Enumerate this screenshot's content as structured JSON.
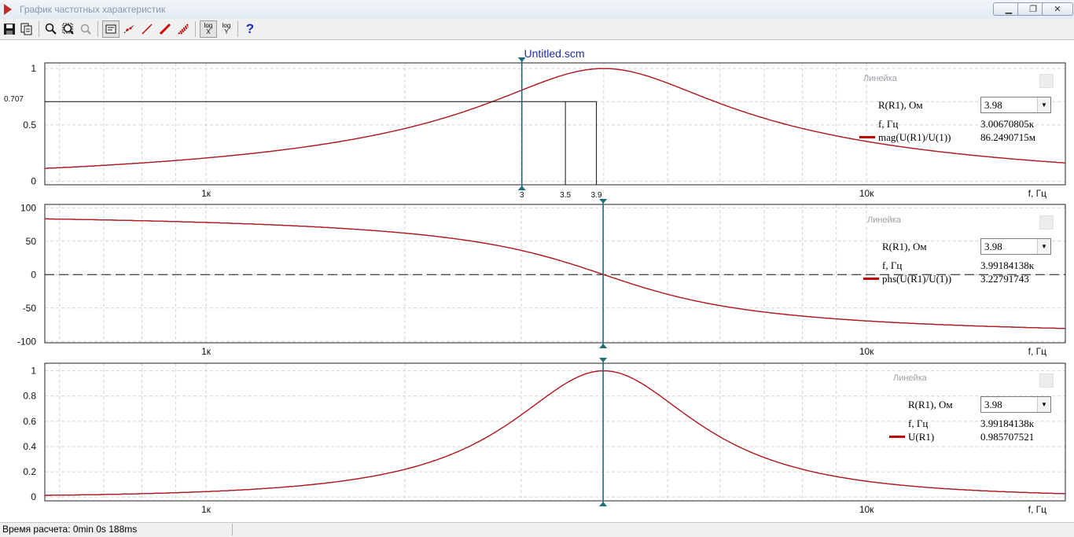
{
  "window": {
    "title": "График частотных характеристик"
  },
  "toolbar": {
    "log_x_1": "log",
    "log_x_2": "X",
    "log_y_1": "log",
    "log_y_2": "Y",
    "help": "?"
  },
  "plot_title": "Untitled.scm",
  "status": {
    "calc_time": "Время расчета: 0min 0s 188ms"
  },
  "colors": {
    "curve_r3": "#2db52d",
    "curve_r35": "#2020b0",
    "curve_r39": "#cc1111",
    "cursor": "#1f6f7a",
    "grid": "#d4d4d4"
  },
  "chart_data": [
    {
      "type": "line",
      "x_scale": "log",
      "xlabel": "f, Гц",
      "x_ticks": [
        {
          "v": 1000,
          "label": "1к"
        },
        {
          "v": 10000,
          "label": "10к"
        }
      ],
      "y_ticks": [
        {
          "v": 1,
          "label": "1"
        },
        {
          "v": 0.707,
          "label": "0.707"
        },
        {
          "v": 0.5,
          "label": "0.5"
        },
        {
          "v": 0,
          "label": "0"
        }
      ],
      "xlim": [
        570,
        20000
      ],
      "ylim": [
        -0.03,
        1.05
      ],
      "quantity": "magnitude",
      "params": [
        3,
        3.5,
        3.9
      ],
      "f0": 4000,
      "series": [
        {
          "param": 3,
          "color": "#2db52d"
        },
        {
          "param": 3.5,
          "color": "#2020b0"
        },
        {
          "param": 3.9,
          "color": "#cc1111"
        }
      ],
      "markers": [
        {
          "label": "3",
          "x": 3007
        },
        {
          "label": "3.5",
          "x": 3500
        },
        {
          "label": "3.9",
          "x": 3900
        }
      ],
      "level_line": 0.707,
      "cursor_x": 3007,
      "ruler": {
        "title": "Линейка",
        "param_label": "R(R1), Ом",
        "param_value": "3.98",
        "freq_label": "f, Гц",
        "freq_value": "3.00670805к",
        "trace_label": "mag(U(R1)/U(1))",
        "trace_value": "86.2490715м"
      }
    },
    {
      "type": "line",
      "x_scale": "log",
      "xlabel": "f, Гц",
      "x_ticks": [
        {
          "v": 1000,
          "label": "1к"
        },
        {
          "v": 10000,
          "label": "10к"
        }
      ],
      "y_ticks": [
        {
          "v": 100,
          "label": "100"
        },
        {
          "v": 50,
          "label": "50"
        },
        {
          "v": 0,
          "label": "0"
        },
        {
          "v": -50,
          "label": "-50"
        },
        {
          "v": -100,
          "label": "-100"
        }
      ],
      "xlim": [
        570,
        20000
      ],
      "ylim": [
        -102,
        105
      ],
      "quantity": "phase",
      "params": [
        3,
        3.5,
        3.9
      ],
      "f0": 4000,
      "series": [
        {
          "param": 3,
          "color": "#2db52d"
        },
        {
          "param": 3.5,
          "color": "#2020b0"
        },
        {
          "param": 3.9,
          "color": "#cc1111"
        }
      ],
      "cursor_x": 3992,
      "ruler": {
        "title": "Линейка",
        "param_label": "R(R1), Ом",
        "param_value": "3.98",
        "freq_label": "f, Гц",
        "freq_value": "3.99184138к",
        "trace_label": "phs(U(R1)/U(1))",
        "trace_value": "3.22791743"
      }
    },
    {
      "type": "line",
      "x_scale": "log",
      "xlabel": "f, Гц",
      "x_ticks": [
        {
          "v": 1000,
          "label": "1к"
        },
        {
          "v": 10000,
          "label": "10к"
        }
      ],
      "y_ticks": [
        {
          "v": 1,
          "label": "1"
        },
        {
          "v": 0.8,
          "label": "0.8"
        },
        {
          "v": 0.6,
          "label": "0.6"
        },
        {
          "v": 0.4,
          "label": "0.4"
        },
        {
          "v": 0.2,
          "label": "0.2"
        },
        {
          "v": 0,
          "label": "0"
        }
      ],
      "xlim": [
        570,
        20000
      ],
      "ylim": [
        -0.03,
        1.06
      ],
      "quantity": "power",
      "params": [
        3,
        3.5,
        3.9
      ],
      "f0": 4000,
      "series": [
        {
          "param": 3,
          "color": "#2db52d"
        },
        {
          "param": 3.5,
          "color": "#2020b0"
        },
        {
          "param": 3.9,
          "color": "#cc1111"
        }
      ],
      "cursor_x": 3992,
      "ruler": {
        "title": "Линейка",
        "param_label": "R(R1), Ом",
        "param_value": "3.98",
        "freq_label": "f, Гц",
        "freq_value": "3.99184138к",
        "trace_label": "U(R1)",
        "trace_value": "0.985707521"
      }
    }
  ]
}
